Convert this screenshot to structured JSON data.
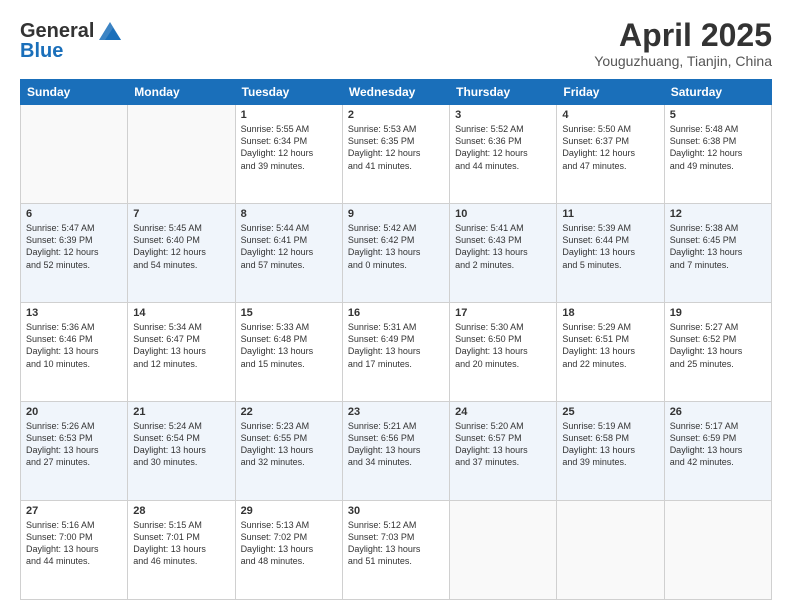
{
  "header": {
    "logo_line1": "General",
    "logo_line2": "Blue",
    "month": "April 2025",
    "location": "Youguzhuang, Tianjin, China"
  },
  "days_of_week": [
    "Sunday",
    "Monday",
    "Tuesday",
    "Wednesday",
    "Thursday",
    "Friday",
    "Saturday"
  ],
  "weeks": [
    [
      {
        "day": "",
        "info": ""
      },
      {
        "day": "",
        "info": ""
      },
      {
        "day": "1",
        "info": "Sunrise: 5:55 AM\nSunset: 6:34 PM\nDaylight: 12 hours\nand 39 minutes."
      },
      {
        "day": "2",
        "info": "Sunrise: 5:53 AM\nSunset: 6:35 PM\nDaylight: 12 hours\nand 41 minutes."
      },
      {
        "day": "3",
        "info": "Sunrise: 5:52 AM\nSunset: 6:36 PM\nDaylight: 12 hours\nand 44 minutes."
      },
      {
        "day": "4",
        "info": "Sunrise: 5:50 AM\nSunset: 6:37 PM\nDaylight: 12 hours\nand 47 minutes."
      },
      {
        "day": "5",
        "info": "Sunrise: 5:48 AM\nSunset: 6:38 PM\nDaylight: 12 hours\nand 49 minutes."
      }
    ],
    [
      {
        "day": "6",
        "info": "Sunrise: 5:47 AM\nSunset: 6:39 PM\nDaylight: 12 hours\nand 52 minutes."
      },
      {
        "day": "7",
        "info": "Sunrise: 5:45 AM\nSunset: 6:40 PM\nDaylight: 12 hours\nand 54 minutes."
      },
      {
        "day": "8",
        "info": "Sunrise: 5:44 AM\nSunset: 6:41 PM\nDaylight: 12 hours\nand 57 minutes."
      },
      {
        "day": "9",
        "info": "Sunrise: 5:42 AM\nSunset: 6:42 PM\nDaylight: 13 hours\nand 0 minutes."
      },
      {
        "day": "10",
        "info": "Sunrise: 5:41 AM\nSunset: 6:43 PM\nDaylight: 13 hours\nand 2 minutes."
      },
      {
        "day": "11",
        "info": "Sunrise: 5:39 AM\nSunset: 6:44 PM\nDaylight: 13 hours\nand 5 minutes."
      },
      {
        "day": "12",
        "info": "Sunrise: 5:38 AM\nSunset: 6:45 PM\nDaylight: 13 hours\nand 7 minutes."
      }
    ],
    [
      {
        "day": "13",
        "info": "Sunrise: 5:36 AM\nSunset: 6:46 PM\nDaylight: 13 hours\nand 10 minutes."
      },
      {
        "day": "14",
        "info": "Sunrise: 5:34 AM\nSunset: 6:47 PM\nDaylight: 13 hours\nand 12 minutes."
      },
      {
        "day": "15",
        "info": "Sunrise: 5:33 AM\nSunset: 6:48 PM\nDaylight: 13 hours\nand 15 minutes."
      },
      {
        "day": "16",
        "info": "Sunrise: 5:31 AM\nSunset: 6:49 PM\nDaylight: 13 hours\nand 17 minutes."
      },
      {
        "day": "17",
        "info": "Sunrise: 5:30 AM\nSunset: 6:50 PM\nDaylight: 13 hours\nand 20 minutes."
      },
      {
        "day": "18",
        "info": "Sunrise: 5:29 AM\nSunset: 6:51 PM\nDaylight: 13 hours\nand 22 minutes."
      },
      {
        "day": "19",
        "info": "Sunrise: 5:27 AM\nSunset: 6:52 PM\nDaylight: 13 hours\nand 25 minutes."
      }
    ],
    [
      {
        "day": "20",
        "info": "Sunrise: 5:26 AM\nSunset: 6:53 PM\nDaylight: 13 hours\nand 27 minutes."
      },
      {
        "day": "21",
        "info": "Sunrise: 5:24 AM\nSunset: 6:54 PM\nDaylight: 13 hours\nand 30 minutes."
      },
      {
        "day": "22",
        "info": "Sunrise: 5:23 AM\nSunset: 6:55 PM\nDaylight: 13 hours\nand 32 minutes."
      },
      {
        "day": "23",
        "info": "Sunrise: 5:21 AM\nSunset: 6:56 PM\nDaylight: 13 hours\nand 34 minutes."
      },
      {
        "day": "24",
        "info": "Sunrise: 5:20 AM\nSunset: 6:57 PM\nDaylight: 13 hours\nand 37 minutes."
      },
      {
        "day": "25",
        "info": "Sunrise: 5:19 AM\nSunset: 6:58 PM\nDaylight: 13 hours\nand 39 minutes."
      },
      {
        "day": "26",
        "info": "Sunrise: 5:17 AM\nSunset: 6:59 PM\nDaylight: 13 hours\nand 42 minutes."
      }
    ],
    [
      {
        "day": "27",
        "info": "Sunrise: 5:16 AM\nSunset: 7:00 PM\nDaylight: 13 hours\nand 44 minutes."
      },
      {
        "day": "28",
        "info": "Sunrise: 5:15 AM\nSunset: 7:01 PM\nDaylight: 13 hours\nand 46 minutes."
      },
      {
        "day": "29",
        "info": "Sunrise: 5:13 AM\nSunset: 7:02 PM\nDaylight: 13 hours\nand 48 minutes."
      },
      {
        "day": "30",
        "info": "Sunrise: 5:12 AM\nSunset: 7:03 PM\nDaylight: 13 hours\nand 51 minutes."
      },
      {
        "day": "",
        "info": ""
      },
      {
        "day": "",
        "info": ""
      },
      {
        "day": "",
        "info": ""
      }
    ]
  ]
}
